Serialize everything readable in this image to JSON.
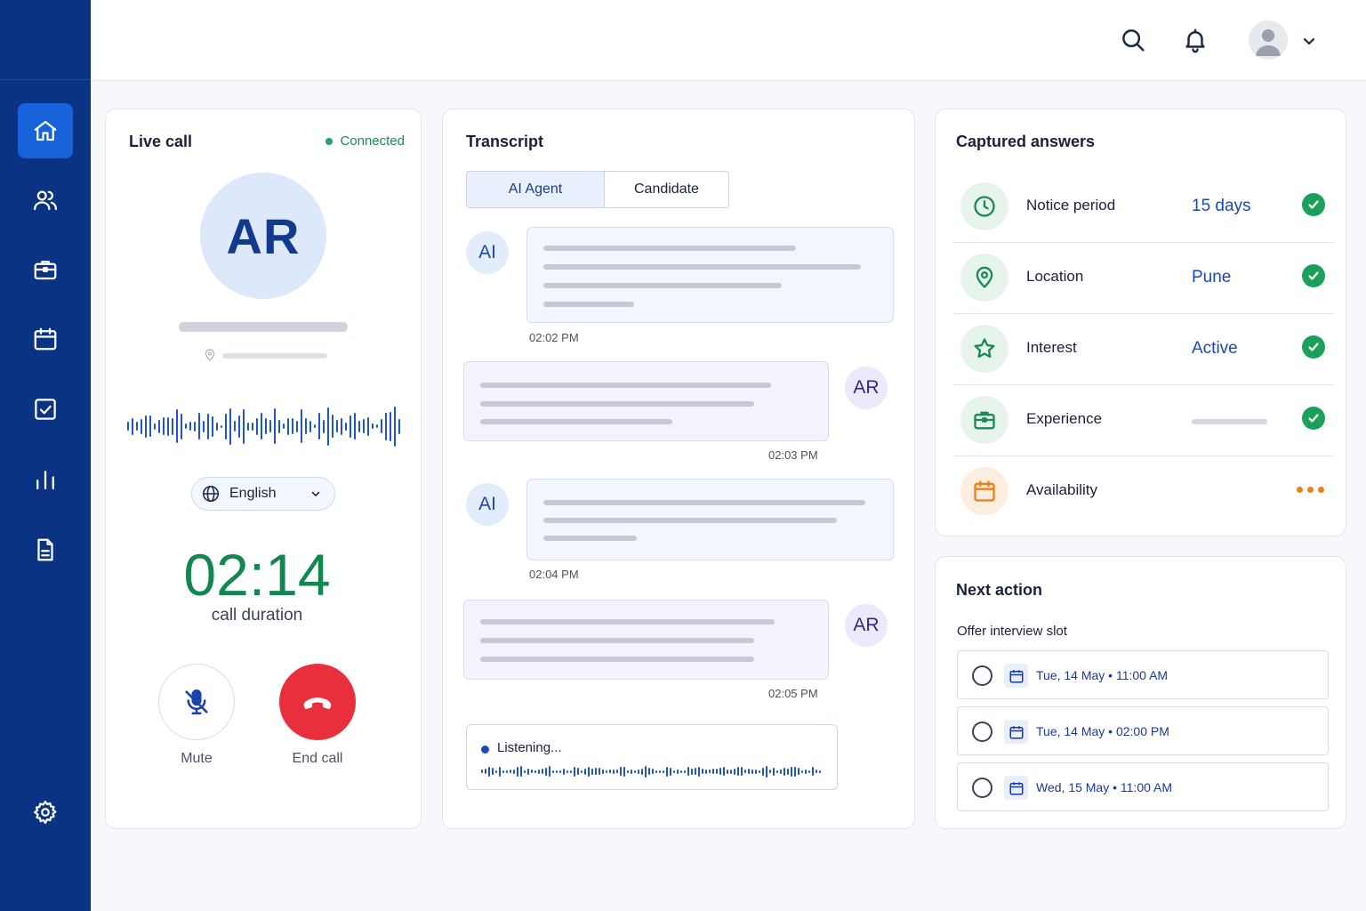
{
  "sidebar": {
    "items": [
      {
        "icon": "home-icon",
        "active": true
      },
      {
        "icon": "users-icon",
        "active": false
      },
      {
        "icon": "briefcase-icon",
        "active": false
      },
      {
        "icon": "calendar-icon",
        "active": false
      },
      {
        "icon": "checkbox-icon",
        "active": false
      },
      {
        "icon": "bar-chart-icon",
        "active": false
      },
      {
        "icon": "document-icon",
        "active": false
      },
      {
        "icon": "gear-icon",
        "active": false
      }
    ]
  },
  "topbar": {
    "icons": [
      "search-icon",
      "bell-icon",
      "avatar",
      "chevron-down-icon"
    ]
  },
  "live_call": {
    "title": "Live call",
    "status": "Connected",
    "initials": "AR",
    "language": "English",
    "duration": "02:14",
    "duration_label": "call duration",
    "mute_label": "Mute",
    "end_label": "End call"
  },
  "transcript": {
    "title": "Transcript",
    "tabs": [
      "AI Agent",
      "Candidate"
    ],
    "active_tab": "AI Agent",
    "messages": [
      {
        "sender": "AI",
        "time": "02:02 PM"
      },
      {
        "sender": "AR",
        "time": "02:03 PM"
      },
      {
        "sender": "AI",
        "time": "02:04 PM"
      },
      {
        "sender": "AR",
        "time": "02:05 PM"
      }
    ],
    "listening": "Listening..."
  },
  "captured": {
    "title": "Captured answers",
    "rows": [
      {
        "label": "Notice period",
        "value": "15 days",
        "status": "done",
        "icon": "clock-icon"
      },
      {
        "label": "Location",
        "value": "Pune",
        "status": "done",
        "icon": "location-pin-icon"
      },
      {
        "label": "Interest",
        "value": "Active",
        "status": "done",
        "icon": "star-icon"
      },
      {
        "label": "Experience",
        "value": "",
        "status": "done",
        "icon": "briefcase-icon"
      },
      {
        "label": "Availability",
        "value": "",
        "status": "pending",
        "icon": "calendar-icon"
      }
    ]
  },
  "next_action": {
    "title": "Next action",
    "subtitle": "Offer interview slot",
    "slots": [
      {
        "date": "Tue, 14 May",
        "time": "11:00 AM",
        "text": "Tue, 14 May  •  11:00 AM"
      },
      {
        "date": "Tue, 14 May",
        "time": "02:00 PM",
        "text": "Tue, 14 May  •  02:00 PM"
      },
      {
        "date": "Wed, 15 May",
        "time": "11:00 AM",
        "text": "Wed, 15 May  •  11:00 AM"
      }
    ]
  },
  "colors": {
    "sidebar": "#0b3384",
    "accent": "#1762db",
    "connected": "#1a8a52",
    "end_call": "#e92f3c",
    "pending": "#ef7f16"
  }
}
